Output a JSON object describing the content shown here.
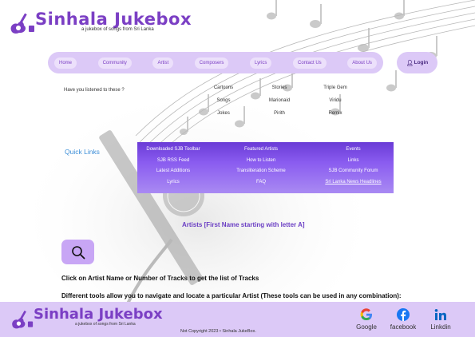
{
  "header": {
    "logo_title": "Sinhala Jukebox",
    "logo_subtitle": "a jukebox of songs from Sri Lanka"
  },
  "nav": {
    "items": [
      "Home",
      "Community",
      "Artist",
      "Composers",
      "Lyrics",
      "Contact Us",
      "About Us"
    ],
    "login_label": "Login"
  },
  "listened": {
    "question": "Have you listened to these ?",
    "links": [
      "Cartoons",
      "Stories",
      "Triple Gem",
      "Songs",
      "Marionaid",
      "Viridu",
      "Jokes",
      "Pirith",
      "Remix"
    ]
  },
  "quick_links": {
    "label": "Quick Links",
    "items": [
      "Downloaded SJB Toolbar",
      "Featured Artists",
      "Events",
      "SJB RSS Feed",
      "How to Listen",
      "Links",
      "Latest Additions",
      "Transliteration Scheme",
      "SJB Community Forum",
      "Lyrics",
      "FAQ",
      "Sri Lanka News Headlines"
    ]
  },
  "main": {
    "heading": "Artists [First Name starting with letter A]",
    "instruction_1": "Click on Artist Name or Number of Tracks to get the list of Tracks",
    "instruction_2": "Different tools allow you to navigate and locate a particular Artist (These tools can be used in any combination):"
  },
  "footer": {
    "logo_title": "Sinhala Jukebox",
    "logo_subtitle": "a jukebox of songs from Sri Lanka",
    "copyright": "Not Copyright 2023 • Sinhala JukeBox.",
    "social": [
      "Google",
      "facebook",
      "Linkdin"
    ]
  },
  "colors": {
    "brand_purple": "#7b3fc4",
    "nav_bg": "#dcc9f7",
    "quick_links_bg": "#7a4be3",
    "quick_links_label": "#3d8fd8"
  }
}
